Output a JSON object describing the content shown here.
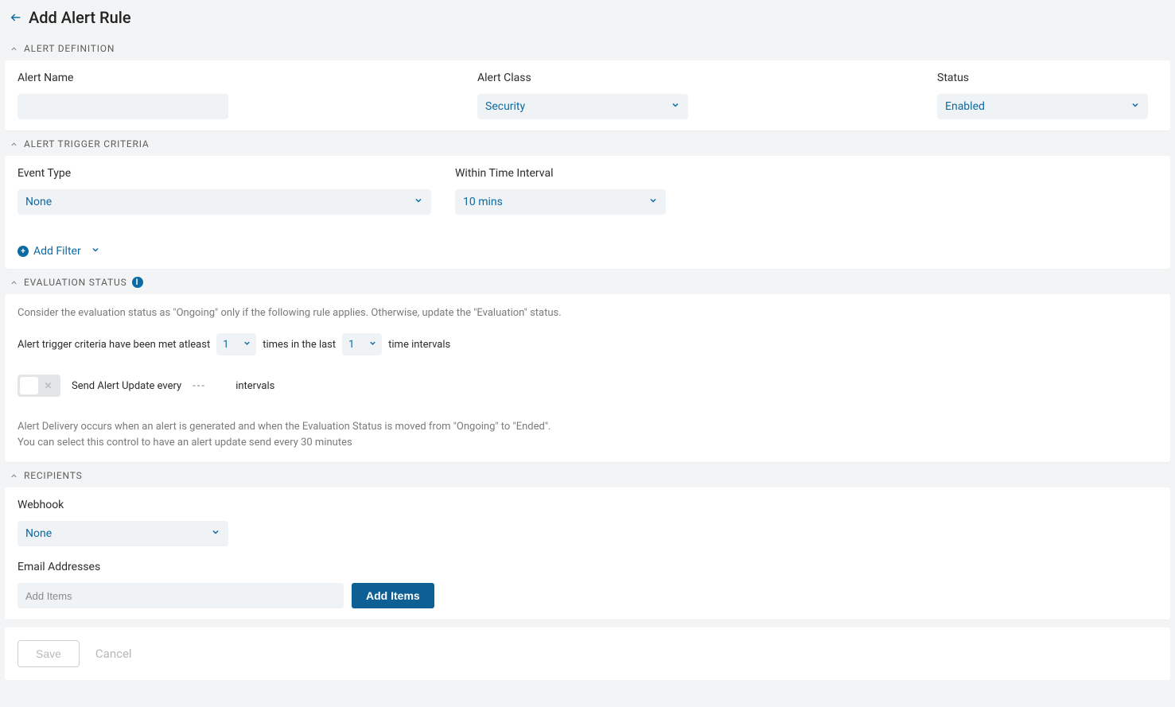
{
  "header": {
    "title": "Add Alert Rule"
  },
  "sections": {
    "definition": {
      "title": "ALERT DEFINITION",
      "alert_name_label": "Alert Name",
      "alert_name_value": "",
      "alert_class_label": "Alert Class",
      "alert_class_value": "Security",
      "status_label": "Status",
      "status_value": "Enabled"
    },
    "trigger": {
      "title": "ALERT TRIGGER CRITERIA",
      "event_type_label": "Event Type",
      "event_type_value": "None",
      "interval_label": "Within Time Interval",
      "interval_value": "10 mins",
      "add_filter_label": "Add Filter"
    },
    "evaluation": {
      "title": "EVALUATION STATUS",
      "hint": "Consider the evaluation status as \"Ongoing\" only if the following rule applies. Otherwise, update the \"Evaluation\" status.",
      "sentence_part1": "Alert trigger criteria have been met atleast",
      "count_value": "1",
      "sentence_part2": "times in the last",
      "interval_count_value": "1",
      "sentence_part3": "time intervals",
      "toggle_label": "Send Alert Update every",
      "toggle_placeholder": "---",
      "toggle_suffix": "intervals",
      "note_line1": "Alert Delivery occurs when an alert is generated and when the Evaluation Status is moved from \"Ongoing\" to \"Ended\".",
      "note_line2": "You can select this control to have an alert update send every 30 minutes"
    },
    "recipients": {
      "title": "RECIPIENTS",
      "webhook_label": "Webhook",
      "webhook_value": "None",
      "email_label": "Email Addresses",
      "email_placeholder": "Add Items",
      "add_items_btn": "Add Items"
    }
  },
  "footer": {
    "save": "Save",
    "cancel": "Cancel"
  }
}
